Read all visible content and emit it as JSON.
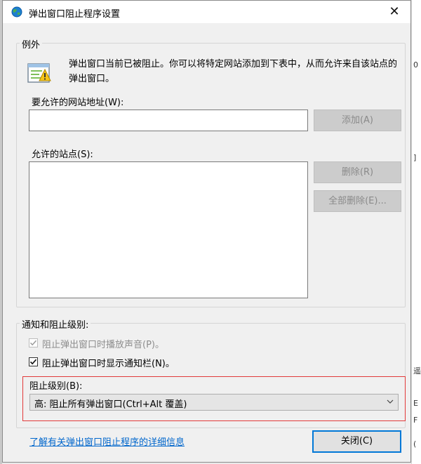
{
  "window": {
    "title": "弹出窗口阻止程序设置",
    "close_glyph": "✕"
  },
  "exceptions": {
    "legend": "例外",
    "info_text": "弹出窗口当前已被阻止。你可以将特定网站添加到下表中，从而允许来自该站点的弹出窗口。",
    "address_label": "要允许的网站地址(W):",
    "address_value": "",
    "add_button": "添加(A)",
    "allowed_label": "允许的站点(S):",
    "allowed_sites": [],
    "remove_button": "删除(R)",
    "remove_all_button": "全部删除(E)..."
  },
  "notifications": {
    "legend": "通知和阻止级别:",
    "play_sound": {
      "label": "阻止弹出窗口时播放声音(P)。",
      "checked": true,
      "disabled": true
    },
    "show_bar": {
      "label": "阻止弹出窗口时显示通知栏(N)。",
      "checked": true,
      "disabled": false
    },
    "level_label": "阻止级别(B):",
    "level_value": "高: 阻止所有弹出窗口(Ctrl+Alt 覆盖)"
  },
  "footer": {
    "learn_more_link": "了解有关弹出窗口阻止程序的详细信息",
    "close_button": "关闭(C)"
  },
  "icons": {
    "title": "ie-globe-icon",
    "info": "popup-blocked-icon",
    "chevron": "chevron-down-icon",
    "check": "checkmark-icon"
  },
  "background": {
    "right_strip_chars": [
      "0",
      "]",
      "遥",
      "E",
      "F",
      "("
    ]
  },
  "colors": {
    "accent": "#0078d7",
    "highlight_border": "#e23a3a",
    "link": "#0066cc"
  }
}
